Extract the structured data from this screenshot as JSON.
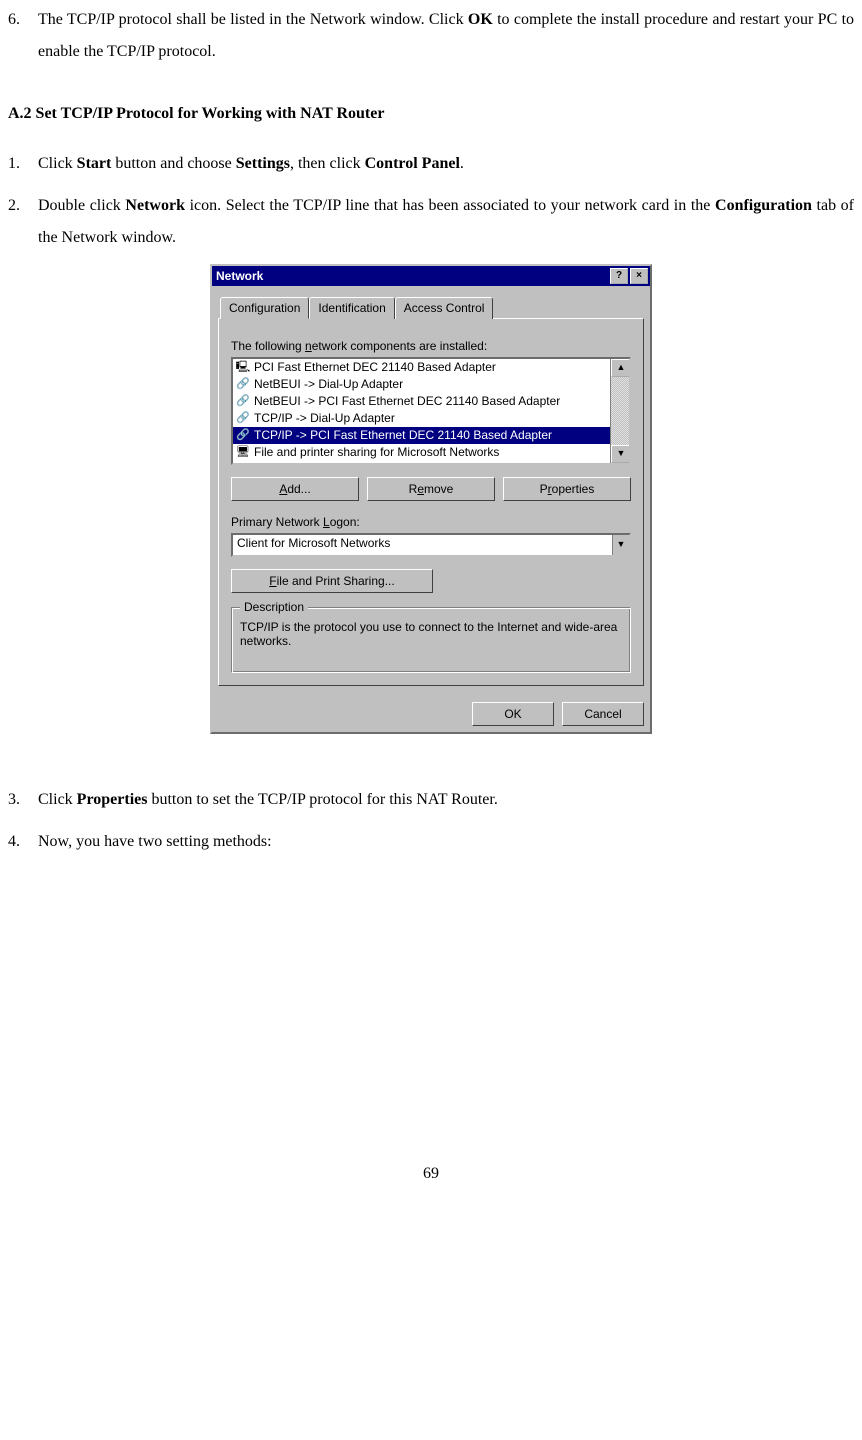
{
  "steps": {
    "s6": {
      "num": "6.",
      "text_pre": "The TCP/IP protocol shall be listed in the Network window. Click ",
      "b1": "OK",
      "text_post": " to complete the install procedure and restart your PC to enable the TCP/IP protocol."
    }
  },
  "sectionA2": "A.2 Set TCP/IP Protocol for Working with NAT Router",
  "a2steps": {
    "s1": {
      "num": "1.",
      "p": [
        {
          "t": "Click "
        },
        {
          "b": "Start"
        },
        {
          "t": " button and choose "
        },
        {
          "b": "Settings"
        },
        {
          "t": ", then click "
        },
        {
          "b": "Control Panel"
        },
        {
          "t": "."
        }
      ]
    },
    "s2": {
      "num": "2.",
      "p": [
        {
          "t": "Double click "
        },
        {
          "b": "Network"
        },
        {
          "t": " icon. Select the TCP/IP line that has been associated to your network card in the "
        },
        {
          "b": "Configuration"
        },
        {
          "t": " tab of the Network window."
        }
      ]
    },
    "s3": {
      "num": "3.",
      "p": [
        {
          "t": "Click "
        },
        {
          "b": "Properties"
        },
        {
          "t": " button to set the TCP/IP protocol for this NAT Router."
        }
      ]
    },
    "s4": {
      "num": "4.",
      "p": [
        {
          "t": "Now, you have two setting methods:"
        }
      ]
    }
  },
  "dialog": {
    "title": "Network",
    "tabs": {
      "t1": "Configuration",
      "t2": "Identification",
      "t3": "Access Control"
    },
    "label_components_pre": "The following ",
    "label_components_u": "n",
    "label_components_post": "etwork components are installed:",
    "list": {
      "i0": "PCI Fast Ethernet DEC 21140 Based Adapter",
      "i1": "NetBEUI -> Dial-Up Adapter",
      "i2": "NetBEUI -> PCI Fast Ethernet DEC 21140 Based Adapter",
      "i3": "TCP/IP -> Dial-Up Adapter",
      "i4": "TCP/IP -> PCI Fast Ethernet DEC 21140 Based Adapter",
      "i5": "File and printer sharing for Microsoft Networks"
    },
    "btn_add_u": "A",
    "btn_add": "dd...",
    "btn_remove_pre": "R",
    "btn_remove_u": "e",
    "btn_remove_post": "move",
    "btn_props_pre": "P",
    "btn_props_u": "r",
    "btn_props_post": "operties",
    "label_logon_pre": "Primary Network ",
    "label_logon_u": "L",
    "label_logon_post": "ogon:",
    "combo_value": "Client for Microsoft Networks",
    "btn_fps_u": "F",
    "btn_fps": "ile and Print Sharing...",
    "group_label": "Description",
    "desc": "TCP/IP is the protocol you use to connect to the Internet and wide-area networks.",
    "ok": "OK",
    "cancel": "Cancel"
  },
  "pagenum": "69"
}
